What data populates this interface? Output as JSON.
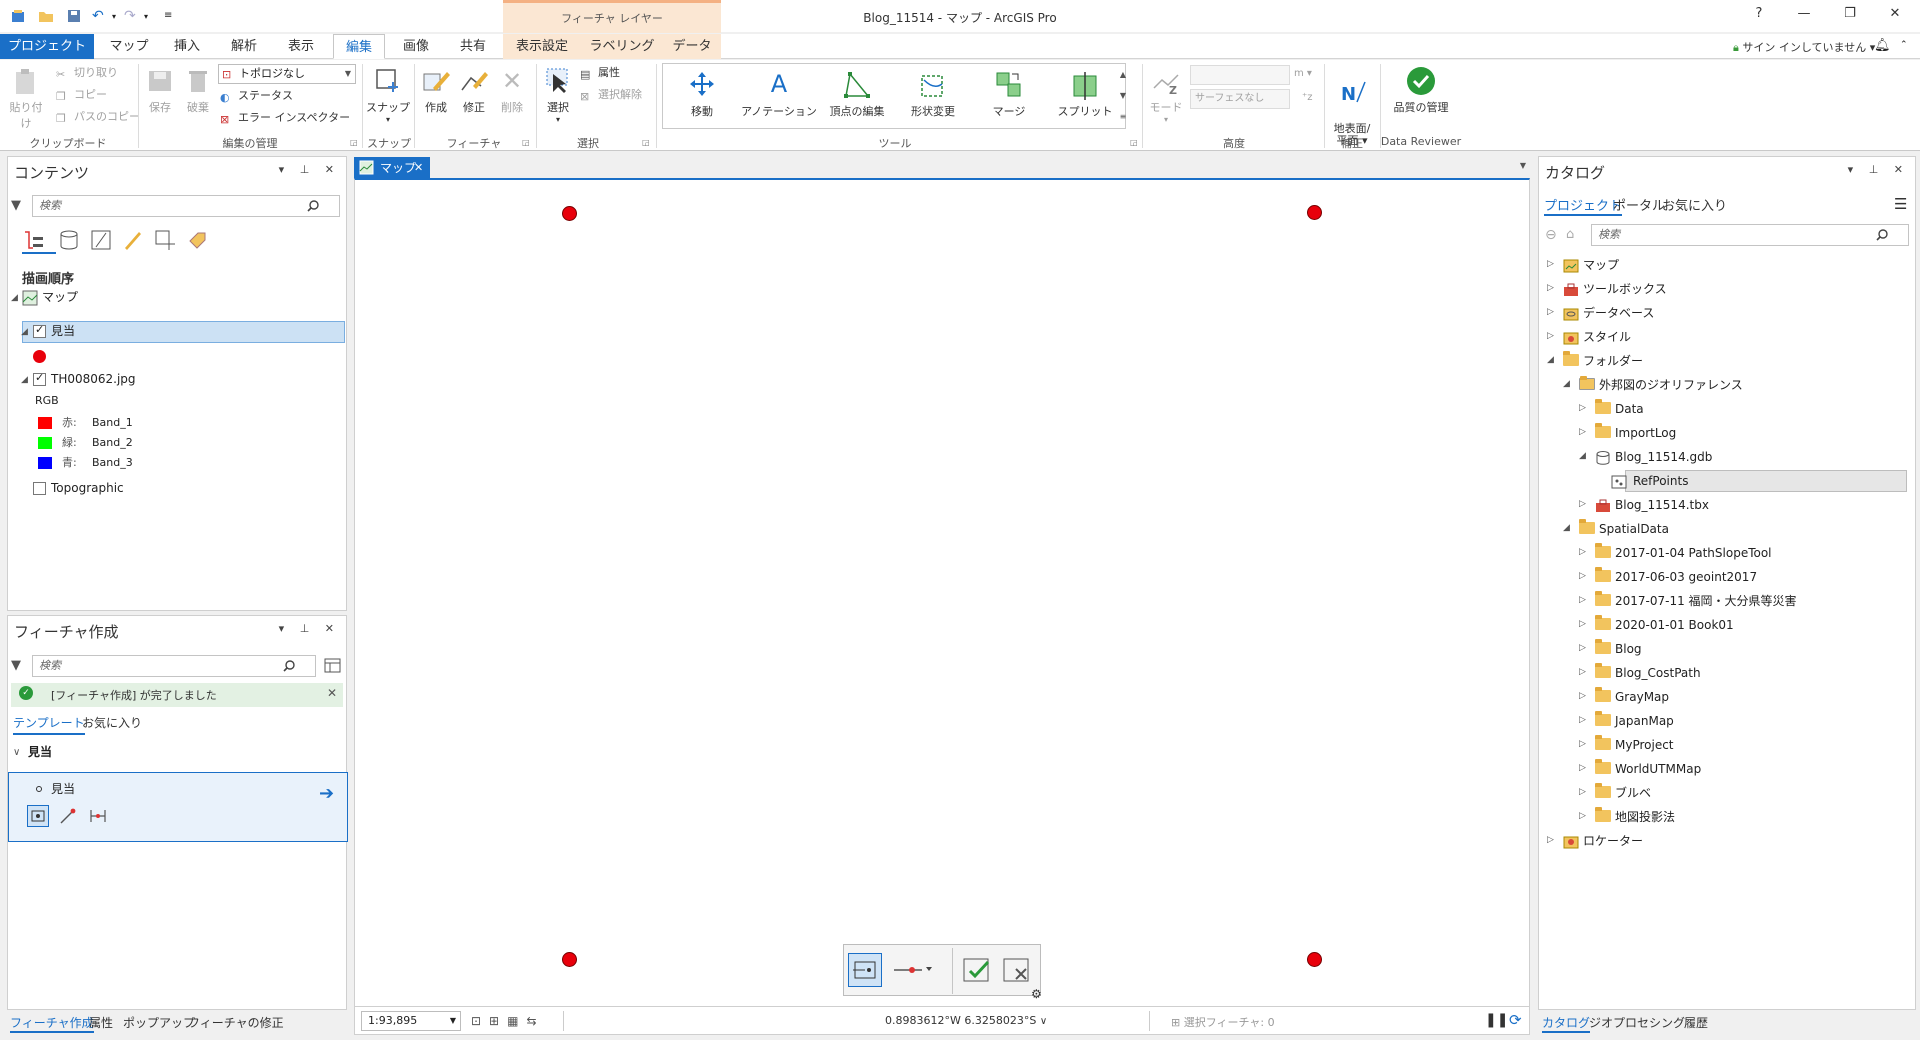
{
  "window": {
    "title": "Blog_11514 - マップ - ArcGIS Pro",
    "context_label": "フィーチャ レイヤー",
    "help": "?",
    "sign_in": "サイン インしていません ▾"
  },
  "tabs": {
    "project": "プロジェクト",
    "map": "マップ",
    "insert": "挿入",
    "analysis": "解析",
    "view": "表示",
    "edit": "編集",
    "imagery": "画像",
    "share": "共有",
    "appearance": "表示設定",
    "labeling": "ラベリング",
    "data": "データ"
  },
  "ribbon": {
    "clipboard": {
      "label": "クリップボード",
      "paste": "貼り付け",
      "cut": "切り取り",
      "copy": "コピー",
      "copy_path": "パスのコピー"
    },
    "manage_edits": {
      "label": "編集の管理",
      "save": "保存",
      "discard": "破棄",
      "topology_value": "トポロジなし",
      "status": "ステータス",
      "error_inspector": "エラー インスペクター"
    },
    "snapping": {
      "label": "スナップ",
      "snap": "スナップ"
    },
    "features": {
      "label": "フィーチャ",
      "create": "作成",
      "modify": "修正",
      "delete": "削除"
    },
    "selection": {
      "label": "選択",
      "select": "選択",
      "attributes": "属性",
      "clear": "選択解除"
    },
    "tools": {
      "label": "ツール",
      "move": "移動",
      "annotation": "アノテーション",
      "edit_vertices": "頂点の編集",
      "reshape": "形状変更",
      "merge": "マージ",
      "split": "スプリット"
    },
    "elevation": {
      "label": "高度",
      "mode": "モード",
      "unit": "m",
      "surface": "サーフェスなし"
    },
    "correct": {
      "label": "補正",
      "ground_grid": "地表面/\n平面 ▾"
    },
    "reviewer": {
      "label": "Data Reviewer",
      "quality": "品質の管理"
    }
  },
  "contents": {
    "title": "コンテンツ",
    "search_placeholder": "検索",
    "heading": "描画順序",
    "map": "マップ",
    "layer_points": "見当",
    "layer_raster": "TH008062.jpg",
    "rgb": "RGB",
    "bands": [
      {
        "channel": "赤:",
        "band": "Band_1",
        "color": "#ff0000"
      },
      {
        "channel": "緑:",
        "band": "Band_2",
        "color": "#00ff00"
      },
      {
        "channel": "青:",
        "band": "Band_3",
        "color": "#0000ff"
      }
    ],
    "layer_basemap": "Topographic"
  },
  "create_features": {
    "title": "フィーチャ作成",
    "search_placeholder": "検索",
    "notice": "[フィーチャ作成] が完了しました",
    "tab_templates": "テンプレート",
    "tab_favorites": "お気に入り",
    "group": "見当",
    "template": "見当"
  },
  "map_view": {
    "tab": "マップ",
    "scale": "1:93,895",
    "coordinates": "0.8983612°W 6.3258023°S",
    "selected_features": "選択フィーチャ: 0"
  },
  "left_bottom_tabs": [
    "フィーチャ作成",
    "属性",
    "ポップアップ",
    "フィーチャの修正"
  ],
  "catalog": {
    "title": "カタログ",
    "tabs": [
      "プロジェクト",
      "ポータル",
      "お気に入り"
    ],
    "search_placeholder": "検索",
    "items": [
      {
        "label": "マップ",
        "level": 0,
        "expand": "▷",
        "kind": "map"
      },
      {
        "label": "ツールボックス",
        "level": 0,
        "expand": "▷",
        "kind": "toolbox"
      },
      {
        "label": "データベース",
        "level": 0,
        "expand": "▷",
        "kind": "database"
      },
      {
        "label": "スタイル",
        "level": 0,
        "expand": "▷",
        "kind": "style"
      },
      {
        "label": "フォルダー",
        "level": 0,
        "expand": "◢",
        "kind": "folder"
      },
      {
        "label": "外邦図のジオリファレンス",
        "level": 1,
        "expand": "◢",
        "kind": "folder-home"
      },
      {
        "label": "Data",
        "level": 2,
        "expand": "▷",
        "kind": "folder"
      },
      {
        "label": "ImportLog",
        "level": 2,
        "expand": "▷",
        "kind": "folder"
      },
      {
        "label": "Blog_11514.gdb",
        "level": 2,
        "expand": "◢",
        "kind": "gdb"
      },
      {
        "label": "RefPoints",
        "level": 3,
        "expand": "",
        "kind": "fc",
        "selected": true
      },
      {
        "label": "Blog_11514.tbx",
        "level": 2,
        "expand": "▷",
        "kind": "toolbox"
      },
      {
        "label": "SpatialData",
        "level": 1,
        "expand": "◢",
        "kind": "folder"
      },
      {
        "label": "2017-01-04 PathSlopeTool",
        "level": 2,
        "expand": "▷",
        "kind": "folder"
      },
      {
        "label": "2017-06-03 geoint2017",
        "level": 2,
        "expand": "▷",
        "kind": "folder"
      },
      {
        "label": "2017-07-11 福岡・大分県等災害",
        "level": 2,
        "expand": "▷",
        "kind": "folder"
      },
      {
        "label": "2020-01-01 Book01",
        "level": 2,
        "expand": "▷",
        "kind": "folder"
      },
      {
        "label": "Blog",
        "level": 2,
        "expand": "▷",
        "kind": "folder"
      },
      {
        "label": "Blog_CostPath",
        "level": 2,
        "expand": "▷",
        "kind": "folder"
      },
      {
        "label": "GrayMap",
        "level": 2,
        "expand": "▷",
        "kind": "folder"
      },
      {
        "label": "JapanMap",
        "level": 2,
        "expand": "▷",
        "kind": "folder"
      },
      {
        "label": "MyProject",
        "level": 2,
        "expand": "▷",
        "kind": "folder"
      },
      {
        "label": "WorldUTMMap",
        "level": 2,
        "expand": "▷",
        "kind": "folder"
      },
      {
        "label": "ブルベ",
        "level": 2,
        "expand": "▷",
        "kind": "folder"
      },
      {
        "label": "地図投影法",
        "level": 2,
        "expand": "▷",
        "kind": "folder"
      },
      {
        "label": "ロケーター",
        "level": 0,
        "expand": "▷",
        "kind": "locator"
      }
    ]
  },
  "right_bottom_tabs": [
    "カタログ",
    "ジオプロセシング",
    "履歴"
  ],
  "colors": {
    "accent": "#1a6fc7",
    "point": "#e8000b",
    "context_band": "#fbe7d3"
  }
}
